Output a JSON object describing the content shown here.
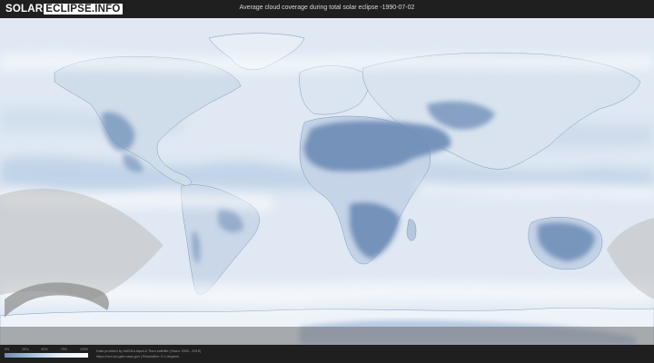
{
  "header": {
    "logo_part1": "SOLAR",
    "logo_part2": "ECLIPSE.INFO",
    "title": "Average cloud coverage during total solar eclipse -1990-07-02"
  },
  "legend": {
    "ticks": [
      "0%",
      "25%",
      "50%",
      "75%",
      "100%"
    ],
    "gradient_colors": [
      "#6b8bb5",
      "#a9c0dc",
      "#e5eef8",
      "#ffffff"
    ]
  },
  "footer": {
    "credit_line1": "Data provided by NASA's Aqua & Terra satellite (Years: 2000 - 2019)",
    "credit_line2": "https://neo.sci.gsfc.nasa.gov | Resolution: 0.1 degrees"
  },
  "colors": {
    "background": "#1f1f1f",
    "cloud": "#ffffff",
    "clear_sky": "#6b8bb5",
    "eclipse_overlay": "#bfbfbf"
  }
}
